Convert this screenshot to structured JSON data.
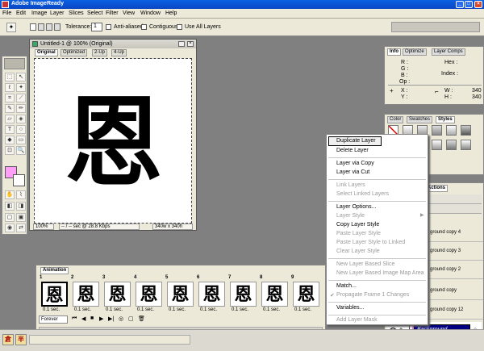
{
  "app": {
    "title": "Adobe ImageReady"
  },
  "menu": [
    "File",
    "Edit",
    "Image",
    "Layer",
    "Slices",
    "Select",
    "Filter",
    "View",
    "Window",
    "Help"
  ],
  "options": {
    "tolerance_label": "Tolerance:",
    "tolerance_value": "1",
    "anti_aliased": "Anti-aliased",
    "contiguous": "Contiguous",
    "use_all_layers": "Use All Layers"
  },
  "document": {
    "title": "Untitled-1 @ 100% (Original)",
    "tabs": [
      "Original",
      "Optimized",
      "2-Up",
      "4-Up"
    ],
    "active_tab": 0,
    "artwork_glyph": "恩",
    "status": {
      "zoom": "100%",
      "download": "-- / -- sec @ 28.8 Kbps",
      "size": "340w x 340h"
    }
  },
  "info_panel": {
    "tabs": [
      "Info",
      "Optimize",
      "Layer Comps"
    ],
    "labels": {
      "r": "R :",
      "g": "G :",
      "b": "B :",
      "op": "Op :",
      "hex": "Hex :",
      "index": "Index :",
      "x": "X :",
      "y": "Y :",
      "w": "W :",
      "h": "H :"
    },
    "w_value": "340",
    "h_value": "340"
  },
  "styles_panel": {
    "tabs": [
      "Color",
      "Swatches",
      "Styles"
    ]
  },
  "animation": {
    "title": "Animation",
    "frames": [
      {
        "num": "1",
        "delay": "0.1 sec."
      },
      {
        "num": "2",
        "delay": "0.1 sec."
      },
      {
        "num": "3",
        "delay": "0.1 sec."
      },
      {
        "num": "4",
        "delay": "0.1 sec."
      },
      {
        "num": "5",
        "delay": "0.1 sec."
      },
      {
        "num": "6",
        "delay": "0.1 sec."
      },
      {
        "num": "7",
        "delay": "0.1 sec."
      },
      {
        "num": "8",
        "delay": "0.1 sec."
      },
      {
        "num": "9",
        "delay": "0.1 sec."
      }
    ],
    "loop": "Forever"
  },
  "context_menu": {
    "items": [
      {
        "label": "Duplicate Layer",
        "disabled": false
      },
      {
        "label": "Delete Layer",
        "disabled": false
      },
      {
        "label": "Layer via Copy",
        "disabled": false
      },
      {
        "label": "Layer via Cut",
        "disabled": false
      },
      {
        "label": "Link Layers",
        "disabled": true
      },
      {
        "label": "Select Linked Layers",
        "disabled": true
      },
      {
        "label": "Layer Options...",
        "disabled": false
      },
      {
        "label": "Layer Style",
        "disabled": true
      },
      {
        "label": "Copy Layer Style",
        "disabled": false
      },
      {
        "label": "Paste Layer Style",
        "disabled": true
      },
      {
        "label": "Paste Layer Style to Linked",
        "disabled": true
      },
      {
        "label": "Clear Layer Style",
        "disabled": true
      },
      {
        "label": "New Layer Based Slice",
        "disabled": true
      },
      {
        "label": "New Layer Based Image Map Area",
        "disabled": true
      },
      {
        "label": "Match...",
        "disabled": false
      },
      {
        "label": "Propagate Frame 1 Changes",
        "disabled": true
      },
      {
        "label": "Variables...",
        "disabled": false
      },
      {
        "label": "Add Layer Mask",
        "disabled": true
      }
    ]
  },
  "layers_panel": {
    "tab": "Actions",
    "rows": [
      {
        "name": "ground copy 4"
      },
      {
        "name": "ground copy 3"
      },
      {
        "name": "ground copy 2"
      },
      {
        "name": "ground copy"
      },
      {
        "name": "ground copy 12"
      },
      {
        "name": "Background"
      }
    ]
  },
  "taskbar": {
    "ime1": "倉",
    "ime2": "半"
  }
}
